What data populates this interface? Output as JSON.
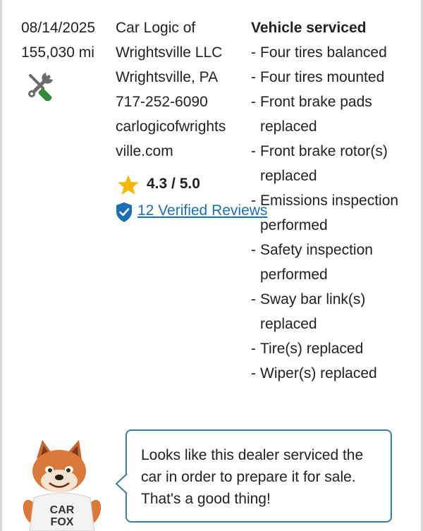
{
  "record": {
    "date": "08/14/2025",
    "odometer": "155,030 mi",
    "service_icon": "wrench-screwdriver-icon"
  },
  "dealer": {
    "name_line1": "Car Logic of",
    "name_line2": "Wrightsville LLC",
    "location": "Wrightsville, PA",
    "phone": "717-252-6090",
    "website_line1": "carlogicofwrights",
    "website_line2": "ville.com",
    "rating": "4.3 / 5.0",
    "rating_icon": "star-icon",
    "reviews_label": "12 Verified Reviews",
    "verified_icon": "shield-check-icon"
  },
  "services": {
    "title": "Vehicle serviced",
    "items": [
      {
        "dash": "-",
        "text": "Four tires balanced"
      },
      {
        "dash": "-",
        "text": "Four tires mounted"
      },
      {
        "dash": "-",
        "text": "Front brake pads replaced"
      },
      {
        "dash": "-",
        "text": "Front brake rotor(s) replaced"
      },
      {
        "dash": "-",
        "text": "Emissions inspection performed"
      },
      {
        "dash": "-",
        "text": "Safety inspection performed"
      },
      {
        "dash": "-",
        "text": "Sway bar link(s) replaced"
      },
      {
        "dash": "-",
        "text": "Tire(s) replaced"
      },
      {
        "dash": "-",
        "text": "Wiper(s) replaced"
      }
    ]
  },
  "mascot": {
    "shirt_line1": "CAR",
    "shirt_line2": "FOX",
    "message": "Looks like this dealer serviced the car in order to prepare it for sale. That's a good thing!"
  },
  "colors": {
    "link": "#1b6fb8",
    "star": "#f5b800",
    "bubble_border": "#3b7fa6",
    "wrench": "#6b6b6b",
    "screwdriver_handle": "#2e8b3a"
  }
}
